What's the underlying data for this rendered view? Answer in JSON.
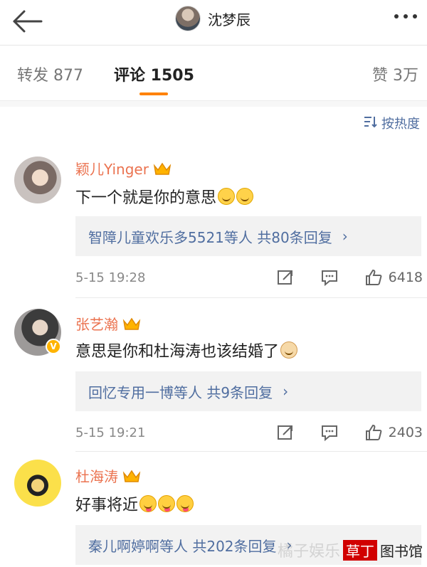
{
  "header": {
    "back_icon": "back-arrow-icon",
    "title": "沈梦辰",
    "more_icon": "more-dots-icon"
  },
  "tabs": {
    "repost": "转发 877",
    "comments": "评论 1505",
    "likes": "赞 3万",
    "active_color": "#ff8200"
  },
  "sort": {
    "icon": "sort-icon",
    "label": "按热度"
  },
  "comments": [
    {
      "name": "颖儿Yinger",
      "text": "下一个就是你的意思",
      "emojis": [
        "grin",
        "grin"
      ],
      "replies": "智障儿童欢乐多5521等人  共80条回复",
      "time": "5-15 19:28",
      "likes": "6418"
    },
    {
      "name": "张艺瀚",
      "text": "意思是你和杜海涛也该结婚了",
      "emojis": [
        "cat"
      ],
      "replies": "回忆专用一博等人  共9条回复",
      "time": "5-15 19:21",
      "likes": "2403"
    },
    {
      "name": "杜海涛",
      "text": "好事将近",
      "emojis": [
        "love",
        "love",
        "love"
      ],
      "replies": "秦儿啊婷啊等人  共202条回复"
    }
  ],
  "watermark": {
    "faint": "橘子娱乐",
    "red": "草丁",
    "dark": "图书馆"
  },
  "colors": {
    "name": "#eb7350",
    "link": "#506ea0",
    "meta": "#888888"
  }
}
